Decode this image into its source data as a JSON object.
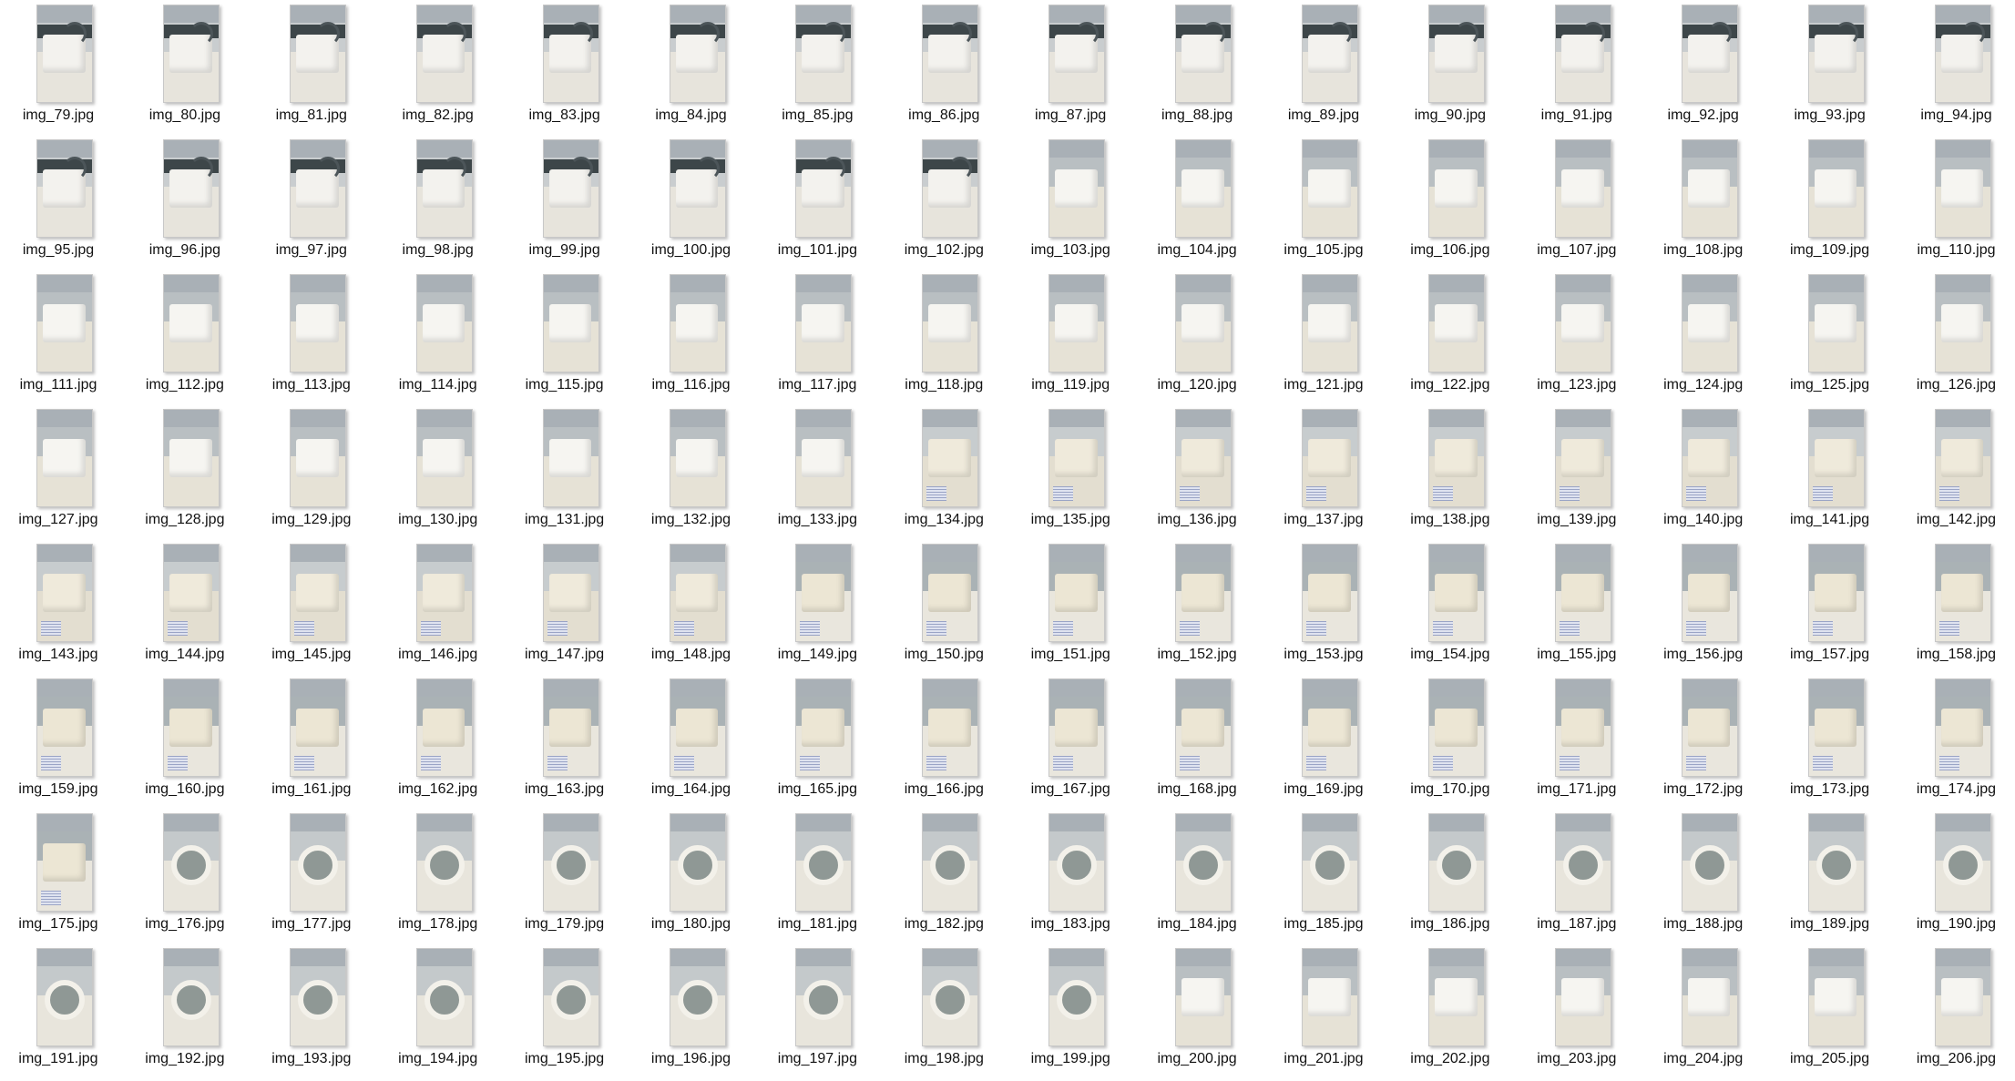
{
  "files": [
    {
      "name": "img_79.jpg",
      "scene": "arm"
    },
    {
      "name": "img_80.jpg",
      "scene": "arm"
    },
    {
      "name": "img_81.jpg",
      "scene": "arm"
    },
    {
      "name": "img_82.jpg",
      "scene": "arm"
    },
    {
      "name": "img_83.jpg",
      "scene": "arm"
    },
    {
      "name": "img_84.jpg",
      "scene": "arm"
    },
    {
      "name": "img_85.jpg",
      "scene": "arm"
    },
    {
      "name": "img_86.jpg",
      "scene": "arm"
    },
    {
      "name": "img_87.jpg",
      "scene": "arm"
    },
    {
      "name": "img_88.jpg",
      "scene": "arm"
    },
    {
      "name": "img_89.jpg",
      "scene": "arm"
    },
    {
      "name": "img_90.jpg",
      "scene": "arm"
    },
    {
      "name": "img_91.jpg",
      "scene": "arm"
    },
    {
      "name": "img_92.jpg",
      "scene": "arm"
    },
    {
      "name": "img_93.jpg",
      "scene": "arm"
    },
    {
      "name": "img_94.jpg",
      "scene": "arm"
    },
    {
      "name": "img_95.jpg",
      "scene": "arm"
    },
    {
      "name": "img_96.jpg",
      "scene": "arm"
    },
    {
      "name": "img_97.jpg",
      "scene": "arm"
    },
    {
      "name": "img_98.jpg",
      "scene": "arm"
    },
    {
      "name": "img_99.jpg",
      "scene": "arm"
    },
    {
      "name": "img_100.jpg",
      "scene": "arm"
    },
    {
      "name": "img_101.jpg",
      "scene": "arm"
    },
    {
      "name": "img_102.jpg",
      "scene": "arm"
    },
    {
      "name": "img_103.jpg",
      "scene": "box"
    },
    {
      "name": "img_104.jpg",
      "scene": "box"
    },
    {
      "name": "img_105.jpg",
      "scene": "box"
    },
    {
      "name": "img_106.jpg",
      "scene": "box"
    },
    {
      "name": "img_107.jpg",
      "scene": "box"
    },
    {
      "name": "img_108.jpg",
      "scene": "box"
    },
    {
      "name": "img_109.jpg",
      "scene": "box"
    },
    {
      "name": "img_110.jpg",
      "scene": "box"
    },
    {
      "name": "img_111.jpg",
      "scene": "box"
    },
    {
      "name": "img_112.jpg",
      "scene": "box"
    },
    {
      "name": "img_113.jpg",
      "scene": "box"
    },
    {
      "name": "img_114.jpg",
      "scene": "box"
    },
    {
      "name": "img_115.jpg",
      "scene": "box"
    },
    {
      "name": "img_116.jpg",
      "scene": "box"
    },
    {
      "name": "img_117.jpg",
      "scene": "box"
    },
    {
      "name": "img_118.jpg",
      "scene": "box"
    },
    {
      "name": "img_119.jpg",
      "scene": "box"
    },
    {
      "name": "img_120.jpg",
      "scene": "box"
    },
    {
      "name": "img_121.jpg",
      "scene": "box"
    },
    {
      "name": "img_122.jpg",
      "scene": "box"
    },
    {
      "name": "img_123.jpg",
      "scene": "box"
    },
    {
      "name": "img_124.jpg",
      "scene": "box"
    },
    {
      "name": "img_125.jpg",
      "scene": "box"
    },
    {
      "name": "img_126.jpg",
      "scene": "box"
    },
    {
      "name": "img_127.jpg",
      "scene": "box"
    },
    {
      "name": "img_128.jpg",
      "scene": "box"
    },
    {
      "name": "img_129.jpg",
      "scene": "box"
    },
    {
      "name": "img_130.jpg",
      "scene": "box"
    },
    {
      "name": "img_131.jpg",
      "scene": "box"
    },
    {
      "name": "img_132.jpg",
      "scene": "box"
    },
    {
      "name": "img_133.jpg",
      "scene": "box"
    },
    {
      "name": "img_134.jpg",
      "scene": "floor"
    },
    {
      "name": "img_135.jpg",
      "scene": "floor"
    },
    {
      "name": "img_136.jpg",
      "scene": "floor"
    },
    {
      "name": "img_137.jpg",
      "scene": "floor"
    },
    {
      "name": "img_138.jpg",
      "scene": "floor"
    },
    {
      "name": "img_139.jpg",
      "scene": "floor"
    },
    {
      "name": "img_140.jpg",
      "scene": "floor"
    },
    {
      "name": "img_141.jpg",
      "scene": "floor"
    },
    {
      "name": "img_142.jpg",
      "scene": "floor"
    },
    {
      "name": "img_143.jpg",
      "scene": "floor"
    },
    {
      "name": "img_144.jpg",
      "scene": "floor"
    },
    {
      "name": "img_145.jpg",
      "scene": "floor"
    },
    {
      "name": "img_146.jpg",
      "scene": "floor"
    },
    {
      "name": "img_147.jpg",
      "scene": "floor"
    },
    {
      "name": "img_148.jpg",
      "scene": "floor"
    },
    {
      "name": "img_149.jpg",
      "scene": "lab"
    },
    {
      "name": "img_150.jpg",
      "scene": "lab"
    },
    {
      "name": "img_151.jpg",
      "scene": "lab"
    },
    {
      "name": "img_152.jpg",
      "scene": "lab"
    },
    {
      "name": "img_153.jpg",
      "scene": "lab"
    },
    {
      "name": "img_154.jpg",
      "scene": "lab"
    },
    {
      "name": "img_155.jpg",
      "scene": "lab"
    },
    {
      "name": "img_156.jpg",
      "scene": "lab"
    },
    {
      "name": "img_157.jpg",
      "scene": "lab"
    },
    {
      "name": "img_158.jpg",
      "scene": "lab"
    },
    {
      "name": "img_159.jpg",
      "scene": "lab"
    },
    {
      "name": "img_160.jpg",
      "scene": "lab"
    },
    {
      "name": "img_161.jpg",
      "scene": "lab"
    },
    {
      "name": "img_162.jpg",
      "scene": "lab"
    },
    {
      "name": "img_163.jpg",
      "scene": "lab"
    },
    {
      "name": "img_164.jpg",
      "scene": "lab"
    },
    {
      "name": "img_165.jpg",
      "scene": "lab"
    },
    {
      "name": "img_166.jpg",
      "scene": "lab"
    },
    {
      "name": "img_167.jpg",
      "scene": "lab"
    },
    {
      "name": "img_168.jpg",
      "scene": "lab"
    },
    {
      "name": "img_169.jpg",
      "scene": "lab"
    },
    {
      "name": "img_170.jpg",
      "scene": "lab"
    },
    {
      "name": "img_171.jpg",
      "scene": "lab"
    },
    {
      "name": "img_172.jpg",
      "scene": "lab"
    },
    {
      "name": "img_173.jpg",
      "scene": "lab"
    },
    {
      "name": "img_174.jpg",
      "scene": "lab"
    },
    {
      "name": "img_175.jpg",
      "scene": "lab"
    },
    {
      "name": "img_176.jpg",
      "scene": "ring"
    },
    {
      "name": "img_177.jpg",
      "scene": "ring"
    },
    {
      "name": "img_178.jpg",
      "scene": "ring"
    },
    {
      "name": "img_179.jpg",
      "scene": "ring"
    },
    {
      "name": "img_180.jpg",
      "scene": "ring"
    },
    {
      "name": "img_181.jpg",
      "scene": "ring"
    },
    {
      "name": "img_182.jpg",
      "scene": "ring"
    },
    {
      "name": "img_183.jpg",
      "scene": "ring"
    },
    {
      "name": "img_184.jpg",
      "scene": "ring"
    },
    {
      "name": "img_185.jpg",
      "scene": "ring"
    },
    {
      "name": "img_186.jpg",
      "scene": "ring"
    },
    {
      "name": "img_187.jpg",
      "scene": "ring"
    },
    {
      "name": "img_188.jpg",
      "scene": "ring"
    },
    {
      "name": "img_189.jpg",
      "scene": "ring"
    },
    {
      "name": "img_190.jpg",
      "scene": "ring"
    },
    {
      "name": "img_191.jpg",
      "scene": "ring"
    },
    {
      "name": "img_192.jpg",
      "scene": "ring"
    },
    {
      "name": "img_193.jpg",
      "scene": "ring"
    },
    {
      "name": "img_194.jpg",
      "scene": "ring"
    },
    {
      "name": "img_195.jpg",
      "scene": "ring"
    },
    {
      "name": "img_196.jpg",
      "scene": "ring"
    },
    {
      "name": "img_197.jpg",
      "scene": "ring"
    },
    {
      "name": "img_198.jpg",
      "scene": "ring"
    },
    {
      "name": "img_199.jpg",
      "scene": "ring"
    },
    {
      "name": "img_200.jpg",
      "scene": "box"
    },
    {
      "name": "img_201.jpg",
      "scene": "box"
    },
    {
      "name": "img_202.jpg",
      "scene": "box"
    },
    {
      "name": "img_203.jpg",
      "scene": "box"
    },
    {
      "name": "img_204.jpg",
      "scene": "box"
    },
    {
      "name": "img_205.jpg",
      "scene": "box"
    },
    {
      "name": "img_206.jpg",
      "scene": "box"
    }
  ],
  "scene_colors": {
    "arm": {
      "wall": "#c9cdcf",
      "floor": "#e7e4dc",
      "obj": "#f3f2ee"
    },
    "box": {
      "wall": "#b9bfc2",
      "floor": "#e6e2d6",
      "obj": "#f6f5f1"
    },
    "floor": {
      "wall": "#c7ccce",
      "floor": "#e3ded0",
      "obj": "#efeadb"
    },
    "lab": {
      "wall": "#aab2b5",
      "floor": "#e9e6dd",
      "obj": "#ece6d4"
    },
    "ring": {
      "wall": "#c4c9cb",
      "floor": "#e8e5dc",
      "obj": "#f2efe6"
    }
  }
}
